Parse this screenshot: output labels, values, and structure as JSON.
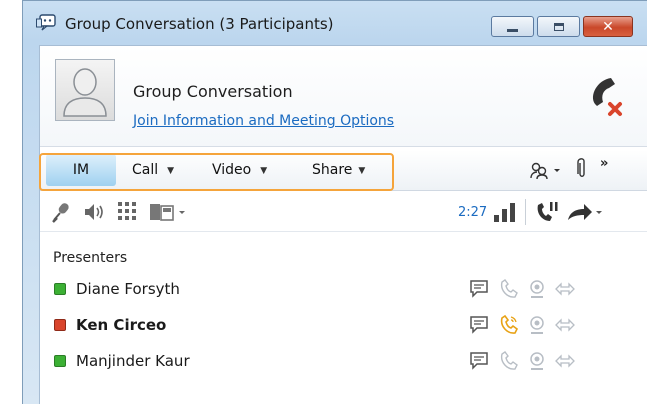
{
  "window": {
    "title": "Group Conversation (3 Participants)"
  },
  "header": {
    "conversation_name": "Group Conversation",
    "join_link": "Join Information and Meeting Options"
  },
  "tabs": [
    {
      "label": "IM",
      "active": true
    },
    {
      "label": "Call"
    },
    {
      "label": "Video"
    },
    {
      "label": "Share"
    }
  ],
  "controls": {
    "call_timer": "2:27"
  },
  "roster": {
    "section": "Presenters",
    "participants": [
      {
        "name": "Diane Forsyth",
        "status": "available",
        "status_color": "#3cb034",
        "bold": false,
        "phone_active": false
      },
      {
        "name": "Ken Circeo",
        "status": "busy",
        "status_color": "#d9442c",
        "bold": true,
        "phone_active": true
      },
      {
        "name": "Manjinder Kaur",
        "status": "available",
        "status_color": "#3cb034",
        "bold": false,
        "phone_active": false
      }
    ]
  },
  "colors": {
    "highlight": "#f5a43b",
    "link": "#1b6bc1",
    "im_tab": "#9fd1f0",
    "hangup": "#d9442c",
    "phone_active": "#e8a317"
  }
}
